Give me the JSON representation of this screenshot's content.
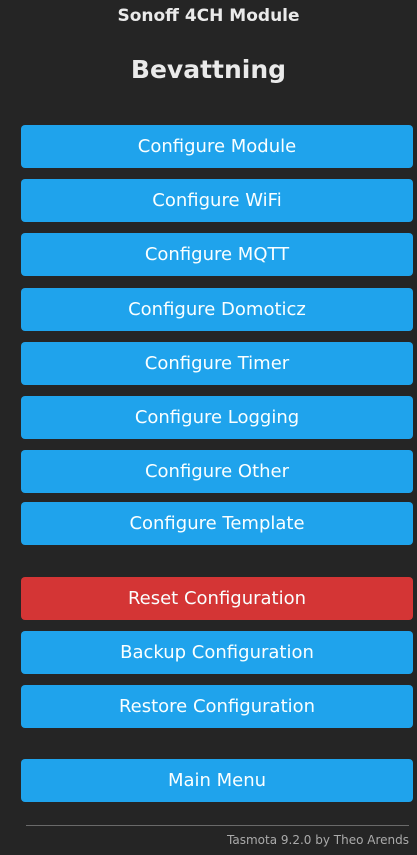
{
  "header": {
    "module_name": "Sonoff 4CH Module",
    "device_name": "Bevattning"
  },
  "config_buttons": {
    "module": "Configure Module",
    "wifi": "Configure WiFi",
    "mqtt": "Configure MQTT",
    "domoticz": "Configure Domoticz",
    "timer": "Configure Timer",
    "logging": "Configure Logging",
    "other": "Configure Other",
    "template": "Configure Template"
  },
  "maintenance_buttons": {
    "reset": "Reset Configuration",
    "backup": "Backup Configuration",
    "restore": "Restore Configuration"
  },
  "nav": {
    "main_menu": "Main Menu"
  },
  "footer": {
    "text": "Tasmota 9.2.0 by Theo Arends"
  },
  "colors": {
    "background": "#252525",
    "button": "#1fa3ec",
    "button_danger": "#d43535",
    "text": "#eaeaea"
  }
}
